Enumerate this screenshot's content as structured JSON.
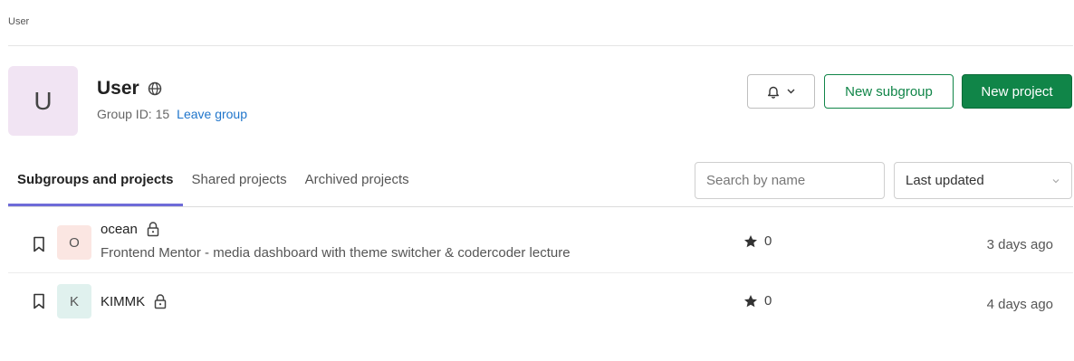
{
  "breadcrumb": {
    "label": "User"
  },
  "group": {
    "avatar_letter": "U",
    "name": "User",
    "id_text": "Group ID: 15",
    "leave_label": "Leave group"
  },
  "actions": {
    "subgroup_label": "New subgroup",
    "project_label": "New project"
  },
  "tabs": [
    {
      "label": "Subgroups and projects",
      "active": true
    },
    {
      "label": "Shared projects",
      "active": false
    },
    {
      "label": "Archived projects",
      "active": false
    }
  ],
  "filter": {
    "search_placeholder": "Search by name",
    "sort_value": "Last updated"
  },
  "projects": [
    {
      "avatar_letter": "O",
      "name": "ocean",
      "description": "Frontend Mentor - media dashboard with theme switcher & codercoder lecture",
      "stars": "0",
      "updated": "3 days ago"
    },
    {
      "avatar_letter": "K",
      "name": "KIMMK",
      "description": "",
      "stars": "0",
      "updated": "4 days ago"
    }
  ],
  "colors": {
    "primary_green": "#108548",
    "link_blue": "#1f75cb",
    "active_tab": "#6e6bd8",
    "group_avatar_bg": "#f1e4f3"
  },
  "icons": [
    "globe-icon",
    "bell-icon",
    "chevron-down-icon",
    "bookmark-icon",
    "lock-icon",
    "star-icon"
  ]
}
